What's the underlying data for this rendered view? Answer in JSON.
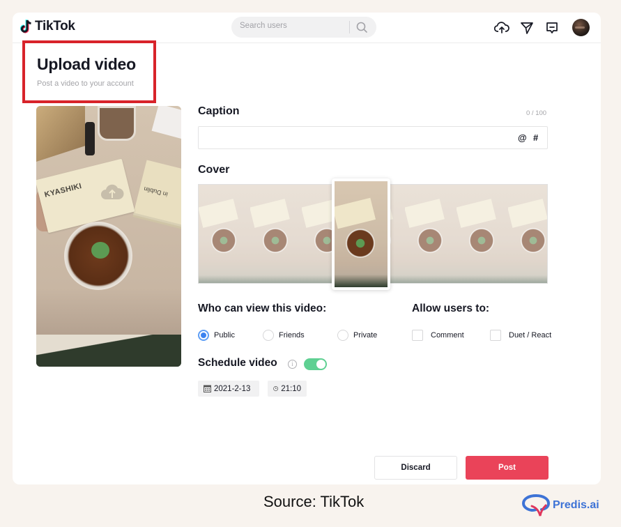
{
  "app": {
    "brand": "TikTok",
    "search_placeholder": "Search users",
    "header_icons": [
      "upload-cloud-icon",
      "send-icon",
      "inbox-message-icon",
      "avatar"
    ]
  },
  "page": {
    "title": "Upload video",
    "subtitle": "Post a video to your account"
  },
  "preview": {
    "card_text": "KYASHIKI",
    "card2_text": "in Dublin"
  },
  "caption": {
    "label": "Caption",
    "counter": "0 / 100",
    "value": "",
    "mention_symbol": "@",
    "hashtag_symbol": "#"
  },
  "cover": {
    "label": "Cover",
    "frame_count": 7,
    "selected_index": 3
  },
  "visibility": {
    "label": "Who can view this video:",
    "options": [
      {
        "label": "Public",
        "selected": true
      },
      {
        "label": "Friends",
        "selected": false
      },
      {
        "label": "Private",
        "selected": false
      }
    ]
  },
  "allow": {
    "label": "Allow users to:",
    "options": [
      {
        "label": "Comment",
        "checked": false
      },
      {
        "label": "Duet / React",
        "checked": false
      }
    ]
  },
  "schedule": {
    "label": "Schedule video",
    "info_symbol": "i",
    "enabled": true,
    "date": "2021-2-13",
    "time": "21:10"
  },
  "actions": {
    "discard": "Discard",
    "post": "Post"
  },
  "footer": {
    "source": "Source: TikTok",
    "brand": "Predis.ai"
  },
  "colors": {
    "accent_post": "#ea4359",
    "toggle_on": "#5fd092",
    "radio_selected": "#3b82f0",
    "highlight_box": "#d8232a",
    "brand_blue": "#3e73d6"
  }
}
